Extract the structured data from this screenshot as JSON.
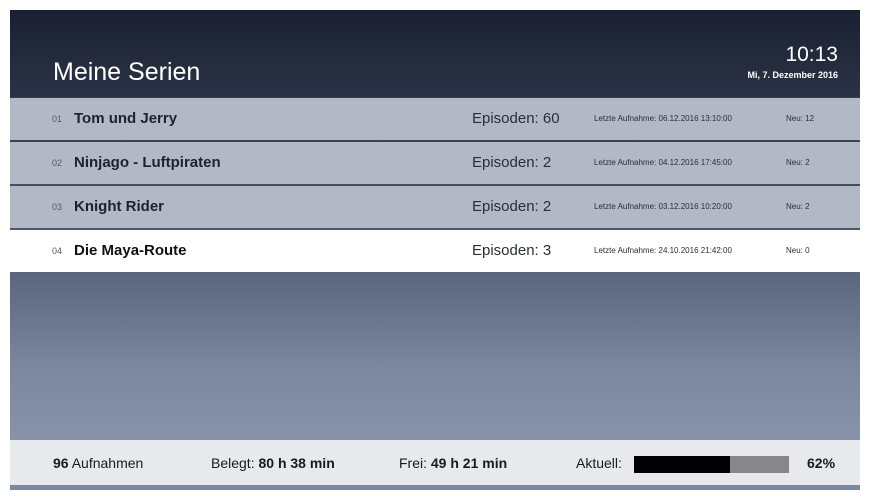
{
  "header": {
    "title": "Meine Serien",
    "time": "10:13",
    "date": "Mi, 7. Dezember 2016"
  },
  "series": [
    {
      "num": "01",
      "name": "Tom und Jerry",
      "episodes": "Episoden: 60",
      "last": "Letzte Aufnahme: 06.12.2016 13:10:00",
      "new": "Neu: 12",
      "selected": false
    },
    {
      "num": "02",
      "name": "Ninjago - Luftpiraten",
      "episodes": "Episoden: 2",
      "last": "Letzte Aufnahme: 04.12.2016 17:45:00",
      "new": "Neu: 2",
      "selected": false
    },
    {
      "num": "03",
      "name": "Knight Rider",
      "episodes": "Episoden: 2",
      "last": "Letzte Aufnahme: 03.12.2016 10:20:00",
      "new": "Neu: 2",
      "selected": false
    },
    {
      "num": "04",
      "name": "Die Maya-Route",
      "episodes": "Episoden: 3",
      "last": "Letzte Aufnahme: 24.10.2016 21:42:00",
      "new": "Neu: 0",
      "selected": true
    }
  ],
  "footer": {
    "recordings_count": "96",
    "recordings_label": "Aufnahmen",
    "used_label": "Belegt:",
    "used_value": "80 h 38 min",
    "free_label": "Frei:",
    "free_value": "49 h 21 min",
    "current_label": "Aktuell:",
    "current_percent_text": "62%",
    "current_fraction": 0.62
  },
  "colors": {
    "row_bg": "#b3b8c6",
    "selected_bg": "#ffffff",
    "progress_fill": "#000000",
    "progress_track": "#878787"
  }
}
